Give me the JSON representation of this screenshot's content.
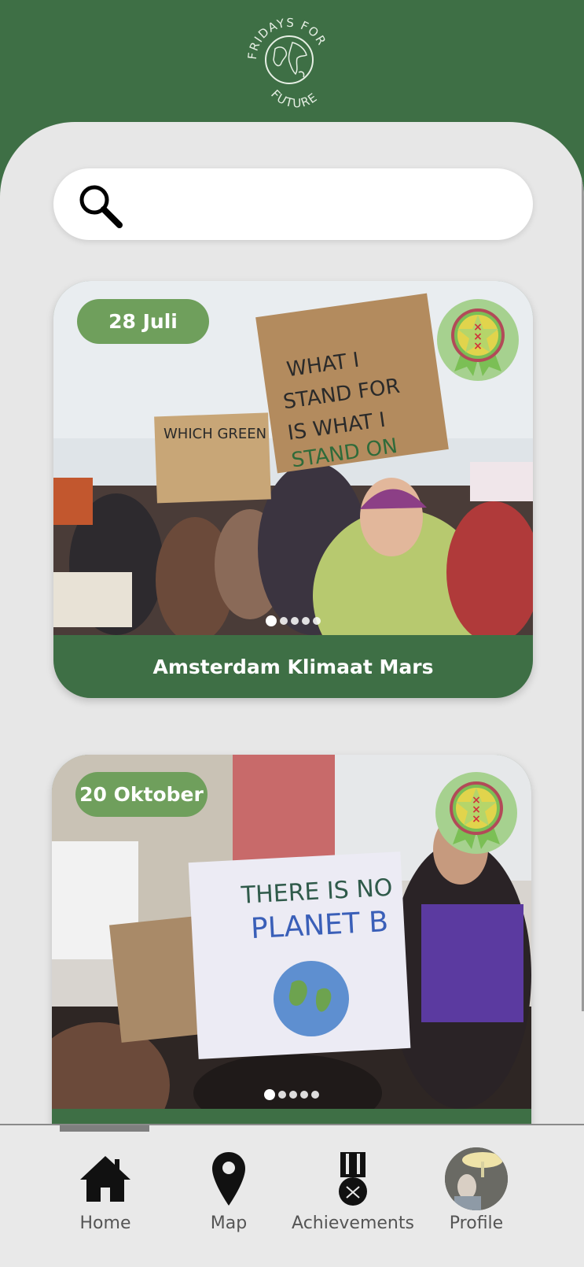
{
  "app": {
    "logo_text_top": "FRIDAYS FOR",
    "logo_text_bottom": "FUTURE"
  },
  "search": {
    "value": "",
    "placeholder": ""
  },
  "events": [
    {
      "date": "28 Juli",
      "title": "Amsterdam Klimaat Mars",
      "carousel_total": 5,
      "carousel_active": 1,
      "badge_icon": "amsterdam-award-icon"
    },
    {
      "date": "20 Oktober",
      "title": "",
      "carousel_total": 5,
      "carousel_active": 1,
      "badge_icon": "amsterdam-award-icon"
    }
  ],
  "nav": {
    "items": [
      {
        "label": "Home",
        "icon": "home-icon"
      },
      {
        "label": "Map",
        "icon": "map-pin-icon"
      },
      {
        "label": "Achievements",
        "icon": "medal-icon"
      },
      {
        "label": "Profile",
        "icon": "avatar"
      }
    ],
    "active": "Home"
  },
  "colors": {
    "brand_green": "#3e6f45",
    "badge_green": "#6f9f5c",
    "award_bg": "#a6d18f",
    "background": "#e7e7e7"
  }
}
